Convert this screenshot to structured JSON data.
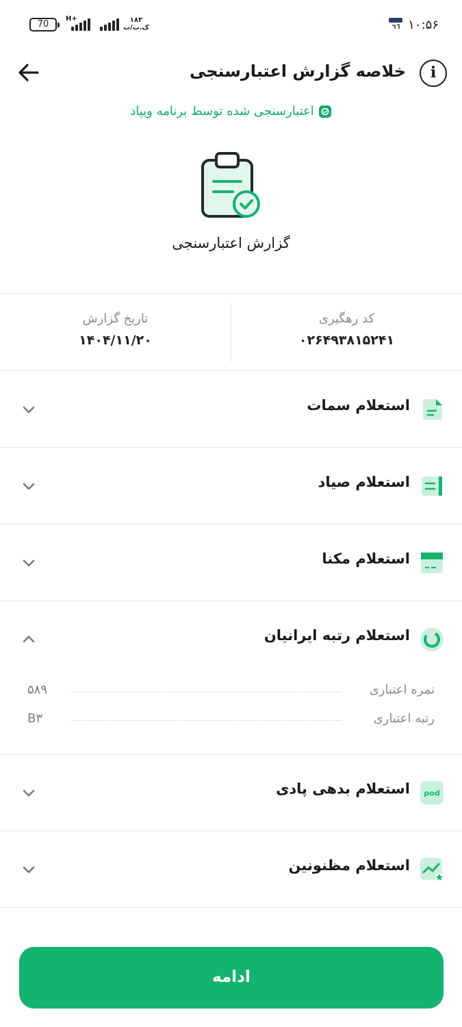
{
  "status_bar": {
    "battery": "70",
    "network": "H+",
    "speed_value": "۱۸۳",
    "speed_unit": "ک.ب/ث",
    "time": "۱۰:۵۶"
  },
  "header": {
    "title": "خلاصه گزارش اعتبارسنجی",
    "info_glyph": "i"
  },
  "verified_text": "اعتبارسنجی شده توسط برنامه ویپاد",
  "hero_label": "گزارش اعتبارسنجی",
  "info": {
    "tracking_label": "کد رهگیری",
    "tracking_value": "۰۲۶۴۹۳۸۱۵۲۴۱",
    "date_label": "تاریخ گزارش",
    "date_value": "۱۴۰۴/۱۱/۲۰"
  },
  "sections": [
    {
      "title": "استعلام سمات",
      "icon": "document-icon",
      "expanded": false
    },
    {
      "title": "استعلام صیاد",
      "icon": "cheque-icon",
      "expanded": false
    },
    {
      "title": "استعلام مکنا",
      "icon": "card-icon",
      "expanded": false
    },
    {
      "title": "استعلام رتبه ایرانیان",
      "icon": "score-gauge-icon",
      "expanded": true,
      "details": [
        {
          "label": "نمره اعتباری",
          "value": "۵۸۹"
        },
        {
          "label": "رتبه اعتباری",
          "value": "B۳"
        }
      ]
    },
    {
      "title": "استعلام بدهی پادی",
      "icon": "pod-icon",
      "expanded": false
    },
    {
      "title": "استعلام مظنونین",
      "icon": "chart-star-icon",
      "expanded": false
    }
  ],
  "continue_label": "ادامه",
  "colors": {
    "accent": "#14b36f",
    "icon_bg": "#c9f0dc",
    "divider": "#e4e4e4"
  }
}
